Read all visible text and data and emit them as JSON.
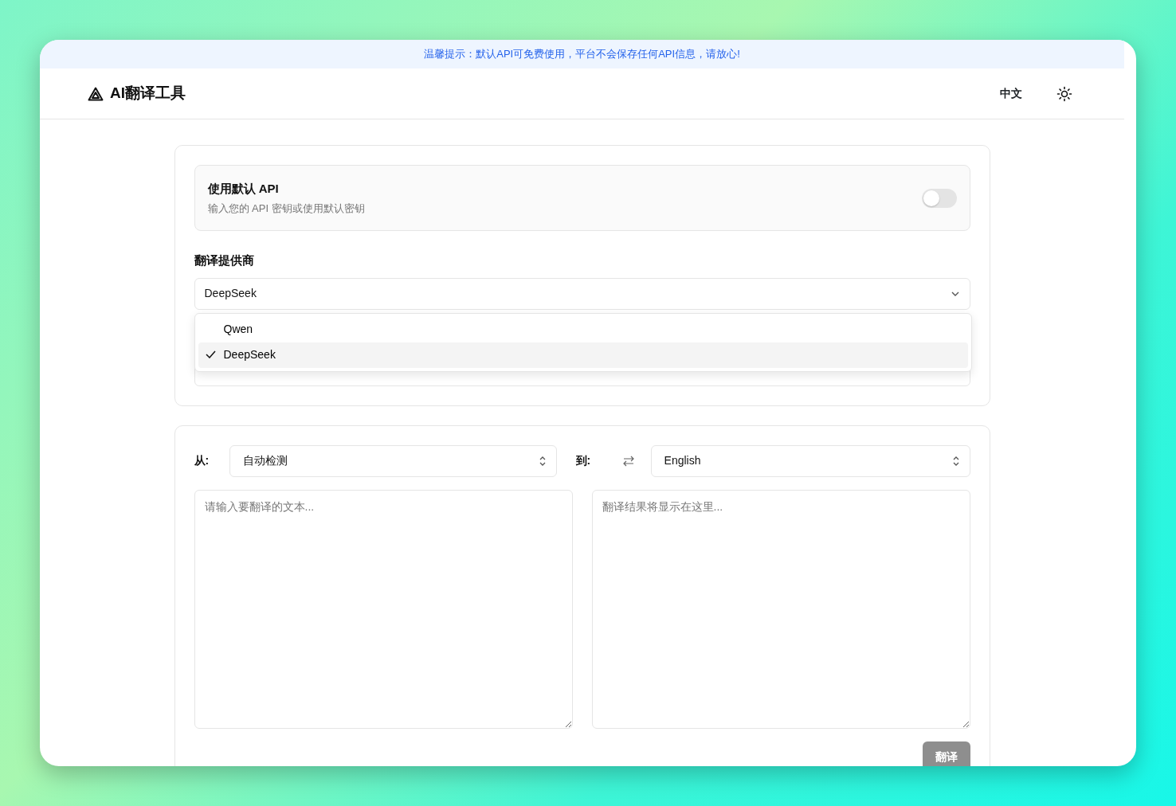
{
  "notice": "温馨提示：默认API可免费使用，平台不会保存任何API信息，请放心!",
  "header": {
    "brand": "AI翻译工具",
    "language": "中文"
  },
  "settings": {
    "default_api": {
      "title": "使用默认 API",
      "subtitle": "输入您的 API 密钥或使用默认密钥",
      "on": false
    },
    "provider_label": "翻译提供商",
    "provider_value": "DeepSeek",
    "provider_options": [
      {
        "label": "Qwen",
        "selected": false
      },
      {
        "label": "DeepSeek",
        "selected": true
      }
    ]
  },
  "translate": {
    "from_label": "从:",
    "from_value": "自动检测",
    "to_label": "到:",
    "to_value": "English",
    "source_placeholder": "请输入要翻译的文本...",
    "result_placeholder": "翻译结果将显示在这里...",
    "button": "翻译",
    "button_disabled": true
  }
}
